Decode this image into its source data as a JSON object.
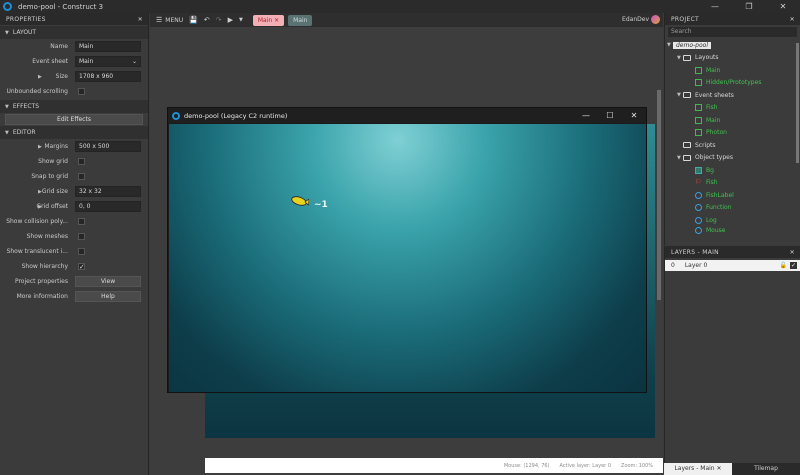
{
  "window": {
    "title": "demo-pool - Construct 3",
    "controls": [
      "—",
      "❐",
      "✕"
    ]
  },
  "properties": {
    "header": "PROPERTIES",
    "close": "✕",
    "sections": {
      "layout": "LAYOUT",
      "effects": "EFFECTS",
      "editor": "EDITOR"
    },
    "layout_rows": {
      "name_label": "Name",
      "name_value": "Main",
      "event_sheet_label": "Event sheet",
      "event_sheet_value": "Main",
      "size_label": "Size",
      "size_value": "1708 x 960",
      "unbounded_label": "Unbounded scrolling"
    },
    "edit_effects_label": "Edit Effects",
    "editor_rows": {
      "margins_label": "Margins",
      "margins_value": "500 x 500",
      "show_grid_label": "Show grid",
      "snap_grid_label": "Snap to grid",
      "grid_size_label": "Grid size",
      "grid_size_value": "32 x 32",
      "grid_offset_label": "Grid offset",
      "grid_offset_value": "0, 0",
      "show_collision_label": "Show collision poly...",
      "show_meshes_label": "Show meshes",
      "show_translucent_label": "Show translucent i...",
      "show_hierarchy_label": "Show hierarchy",
      "project_props_label": "Project properties",
      "project_props_button": "View",
      "more_info_label": "More information",
      "more_info_button": "Help"
    }
  },
  "toolbar": {
    "menu_label": "MENU",
    "tabs": [
      {
        "label": "Main",
        "close": "✕"
      },
      {
        "label": "Main"
      }
    ],
    "user": "EdanDev"
  },
  "preview": {
    "title": "demo-pool (Legacy C2 runtime)",
    "controls": [
      "—",
      "☐",
      "✕"
    ],
    "fish_label": "~1"
  },
  "status": {
    "mouse": "Mouse: (1294, 76)",
    "active_layer": "Active layer: Layer 0",
    "zoom": "Zoom: 100%"
  },
  "project": {
    "header": "PROJECT",
    "close": "✕",
    "search_placeholder": "Search",
    "root": "demo-pool",
    "layouts_label": "Layouts",
    "layouts": [
      "Main",
      "Hidden/Prototypes"
    ],
    "event_sheets_label": "Event sheets",
    "event_sheets": [
      "Fish",
      "Main",
      "Photon"
    ],
    "scripts_label": "Scripts",
    "object_types_label": "Object types",
    "object_types": [
      "Bg",
      "Fish",
      "FishLabel",
      "Function",
      "Log",
      "Mouse"
    ]
  },
  "layers": {
    "header": "LAYERS - MAIN",
    "close": "✕",
    "row_index": "0",
    "row_name": "Layer 0",
    "bottom_tabs": [
      "Layers - Main",
      "Tilemap"
    ],
    "bottom_close": "✕"
  },
  "colors": {
    "accent": "#41c24f",
    "tab_active": "#f3b0b4",
    "water": "#2f8c94"
  }
}
